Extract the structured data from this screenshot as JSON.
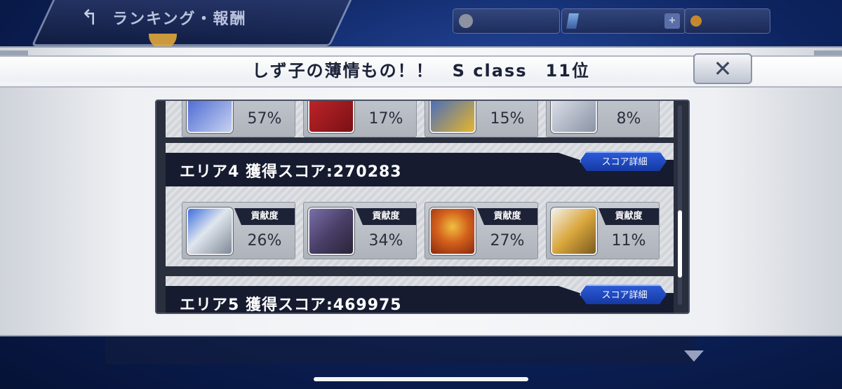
{
  "topbar": {
    "back_title": "ランキング・報酬",
    "back_icon": "back-arrow-icon",
    "resources": [
      {
        "label": "",
        "icon": "round-icon"
      },
      {
        "label": "",
        "icon": "gem-icon"
      },
      {
        "label": "",
        "icon": "coin-icon"
      }
    ]
  },
  "modal": {
    "title": "しず子の薄情もの！！　S class　11位",
    "close_label": "✕"
  },
  "top_partial_area": {
    "units": [
      {
        "percent": "57%"
      },
      {
        "percent": "17%"
      },
      {
        "percent": "15%"
      },
      {
        "percent": "8%"
      }
    ]
  },
  "areas": [
    {
      "title": "エリア4 獲得スコア:270283",
      "detail_label": "スコア詳細",
      "contribution_label": "貢献度",
      "units": [
        {
          "percent": "26%",
          "color": "#dfe6ee"
        },
        {
          "percent": "34%",
          "color": "#4a3f68"
        },
        {
          "percent": "27%",
          "color": "#d4621c"
        },
        {
          "percent": "11%",
          "color": "#d9a63c"
        }
      ]
    },
    {
      "title": "エリア5 獲得スコア:469975",
      "detail_label": "スコア詳細"
    }
  ]
}
